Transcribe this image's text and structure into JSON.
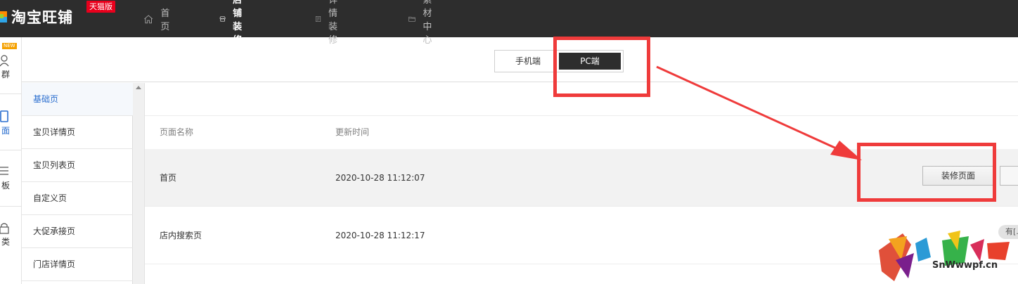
{
  "header": {
    "brand": "淘宝旺铺",
    "badge": "天猫版",
    "nav": [
      {
        "label": "首页",
        "icon": "home-icon",
        "active": false
      },
      {
        "label": "店铺装修",
        "icon": "store-icon",
        "active": true
      },
      {
        "label": "详情装修",
        "icon": "document-icon",
        "active": false
      },
      {
        "label": "素材中心",
        "icon": "folder-icon",
        "active": false
      }
    ]
  },
  "rail": {
    "new_badge": "NEW",
    "items": [
      {
        "label": "群",
        "icon": "user-group-icon"
      },
      {
        "label": "面",
        "icon": "page-icon",
        "active": true
      },
      {
        "label": "板",
        "icon": "template-icon"
      },
      {
        "label": "类",
        "icon": "lock-icon"
      }
    ]
  },
  "switch": {
    "mobile_label": "手机端",
    "pc_label": "PC端",
    "selected": "PC端"
  },
  "sidebar": {
    "items": [
      {
        "label": "基础页",
        "active": true
      },
      {
        "label": "宝贝详情页"
      },
      {
        "label": "宝贝列表页"
      },
      {
        "label": "自定义页"
      },
      {
        "label": "大促承接页"
      },
      {
        "label": "门店详情页"
      }
    ]
  },
  "table": {
    "headers": {
      "name": "页面名称",
      "updated": "更新时间"
    },
    "rows": [
      {
        "name": "首页",
        "updated": "2020-10-28 11:12:07",
        "action": "装修页面"
      },
      {
        "name": "店内搜索页",
        "updated": "2020-10-28 11:12:17",
        "tag": "有[...]"
      }
    ]
  },
  "watermark": {
    "url": "SnWwwpf.cn"
  },
  "colors": {
    "topbar": "#2d2d2d",
    "annotation_red": "#ef3b3b",
    "active_blue": "#2a6ecf",
    "tmall_red": "#e8001c"
  }
}
